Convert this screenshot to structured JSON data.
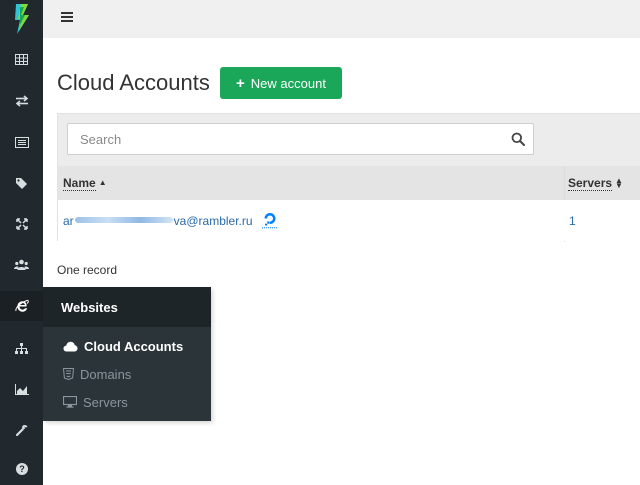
{
  "sidebar": {
    "icons": [
      "table-icon",
      "exchange-icon",
      "list-icon",
      "tag-icon",
      "expand-icon",
      "users-icon",
      "internet-explorer-icon",
      "sitemap-icon",
      "area-chart-icon",
      "wrench-icon",
      "question-circle-icon"
    ],
    "active_icon": "internet-explorer-icon"
  },
  "header": {
    "menu_icon": "hamburger-icon"
  },
  "main": {
    "title": "Cloud Accounts",
    "new_button_label": "New account",
    "search": {
      "placeholder": "Search",
      "value": ""
    },
    "table": {
      "columns": [
        "Name",
        "Servers"
      ],
      "rows": [
        {
          "email_prefix": "ar",
          "email_suffix": "va@rambler.ru",
          "provider_icon": "digitalocean-icon",
          "servers": "1"
        }
      ]
    },
    "record_count": "One record"
  },
  "flyout": {
    "title": "Websites",
    "items": [
      {
        "label": "Cloud Accounts",
        "icon": "cloud-icon",
        "active": true
      },
      {
        "label": "Domains",
        "icon": "html5-icon",
        "active": false
      },
      {
        "label": "Servers",
        "icon": "desktop-icon",
        "active": false
      }
    ]
  },
  "colors": {
    "sidebar_bg": "#22292e",
    "accent_green": "#1aa75a",
    "link_blue": "#2a6aa8"
  }
}
